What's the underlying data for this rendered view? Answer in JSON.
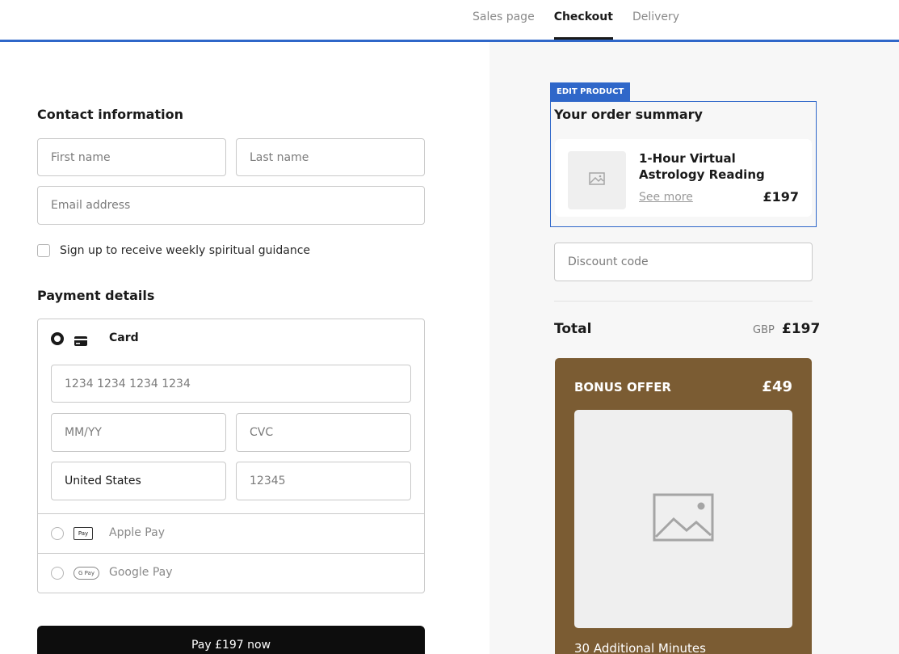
{
  "nav": {
    "tabs": [
      {
        "label": "Sales page",
        "active": false
      },
      {
        "label": "Checkout",
        "active": true
      },
      {
        "label": "Delivery",
        "active": false
      }
    ]
  },
  "contact": {
    "title": "Contact information",
    "first_name_placeholder": "First name",
    "last_name_placeholder": "Last name",
    "email_placeholder": "Email address",
    "newsletter_label": "Sign up to receive weekly spiritual guidance"
  },
  "payment": {
    "title": "Payment details",
    "card_label": "Card",
    "card_number_placeholder": "1234 1234 1234 1234",
    "expiry_placeholder": "MM/YY",
    "cvc_placeholder": "CVC",
    "country_value": "United States",
    "zip_placeholder": "12345",
    "apple_pay_label": "Apple Pay",
    "apple_pay_icon_text": "Pay",
    "google_pay_label": "Google Pay",
    "google_pay_icon_text": "G Pay",
    "pay_button_label": "Pay £197 now"
  },
  "summary": {
    "edit_tag": "EDIT PRODUCT",
    "title": "Your order summary",
    "product_name": "1-Hour Virtual Astrology Reading",
    "see_more": "See more",
    "product_price": "£197",
    "discount_placeholder": "Discount code",
    "total_label": "Total",
    "total_currency": "GBP",
    "total_value": "£197"
  },
  "bonus": {
    "title": "BONUS OFFER",
    "price": "£49",
    "caption": "30 Additional Minutes"
  },
  "colors": {
    "accent": "#2f67c9",
    "bonus_bg": "#7b5c33",
    "pay_button": "#0d0d0d"
  }
}
